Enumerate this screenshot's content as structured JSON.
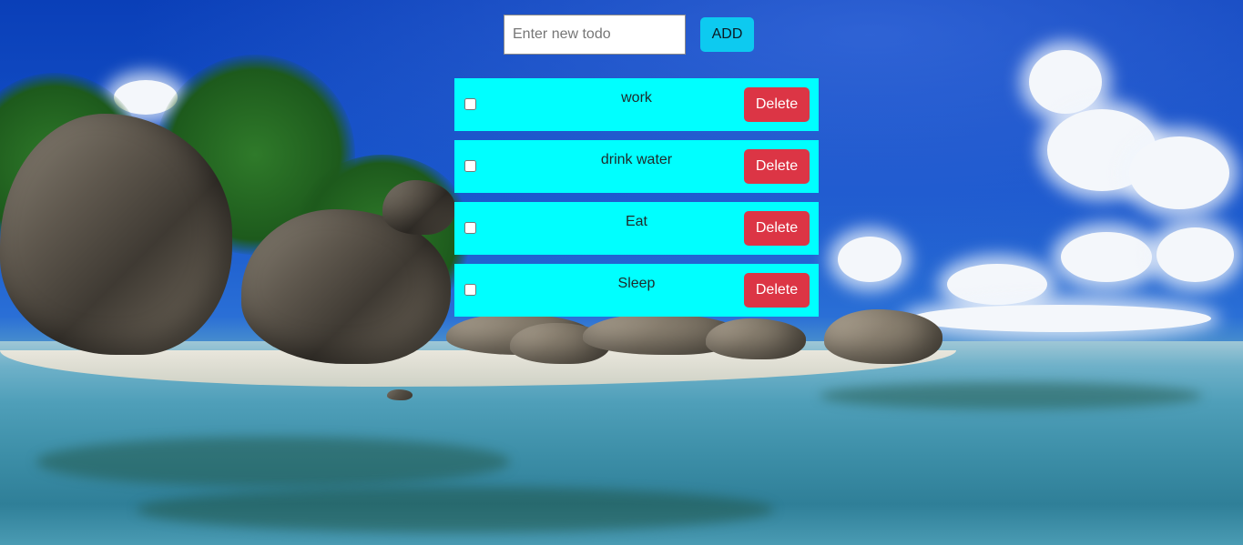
{
  "add_form": {
    "input_value": "",
    "input_placeholder": "Enter new todo",
    "add_label": "ADD"
  },
  "todos": [
    {
      "text": "work",
      "checked": false,
      "delete_label": "Delete"
    },
    {
      "text": "drink water",
      "checked": false,
      "delete_label": "Delete"
    },
    {
      "text": "Eat",
      "checked": false,
      "delete_label": "Delete"
    },
    {
      "text": "Sleep",
      "checked": false,
      "delete_label": "Delete"
    }
  ],
  "colors": {
    "todo_row_bg": "#00ffff",
    "add_button": "#0dcaf0",
    "delete_button": "#dc3545"
  },
  "background": {
    "scene": "tropical beach with granite boulders, palm trees, clouds and turquoise sea"
  }
}
